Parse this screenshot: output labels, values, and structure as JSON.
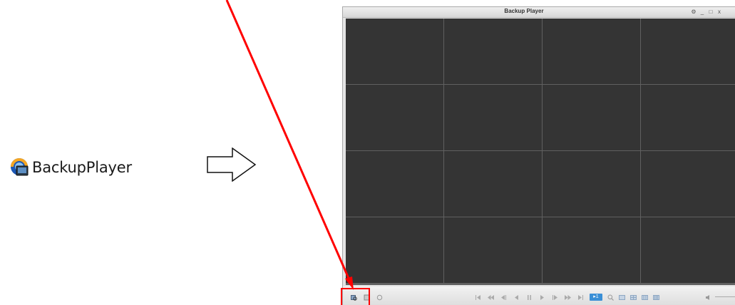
{
  "desktop": {
    "shortcut_label": "BackupPlayer",
    "shortcut_icon": "backup-player-app-icon"
  },
  "window": {
    "title": "Backup Player",
    "controls": {
      "settings": "⚙",
      "minimize": "_",
      "maximize": "□",
      "close": "x"
    },
    "grid": {
      "rows": 4,
      "cols": 4
    }
  },
  "toolbar": {
    "left_tools": [
      "open-file-icon",
      "file-list-icon",
      "link-icon"
    ],
    "playback_tools": [
      "skip-start-icon",
      "rewind-fast-icon",
      "step-back-icon",
      "reverse-play-icon",
      "pause-icon",
      "play-icon",
      "step-forward-icon",
      "fast-forward-icon",
      "skip-end-icon"
    ],
    "speed_badge": "▸1",
    "view_tools": [
      "zoom-icon",
      "layout-1-icon",
      "layout-4-icon",
      "layout-9-icon",
      "layout-16-icon"
    ],
    "volume_icon": "speaker-icon"
  },
  "colors": {
    "callout": "#ff0000",
    "video_bg": "#343434",
    "grid_line": "#606060",
    "accent": "#3a8fd6"
  }
}
